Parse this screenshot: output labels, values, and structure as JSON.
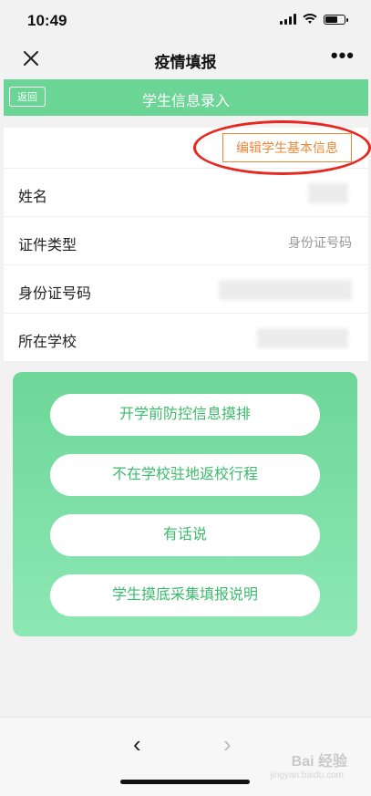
{
  "status_bar": {
    "time": "10:49"
  },
  "nav": {
    "title": "疫情填报",
    "more": "•••"
  },
  "header": {
    "back_label": "返回",
    "title": "学生信息录入"
  },
  "form": {
    "edit_button": "编辑学生基本信息",
    "rows": [
      {
        "label": "姓名",
        "value": ""
      },
      {
        "label": "证件类型",
        "value": "身份证号码"
      },
      {
        "label": "身份证号码",
        "value": ""
      },
      {
        "label": "所在学校",
        "value": ""
      }
    ]
  },
  "menu": {
    "buttons": [
      "开学前防控信息摸排",
      "不在学校驻地返校行程",
      "有话说",
      "学生摸底采集填报说明"
    ]
  },
  "bottom": {
    "back": "‹",
    "forward": "›",
    "watermark": "Bai 经验",
    "watermark_sub": "jingyan.baidu.com"
  },
  "colors": {
    "green": "#6bd595",
    "orange": "#e8893a",
    "red": "#e8271f"
  }
}
